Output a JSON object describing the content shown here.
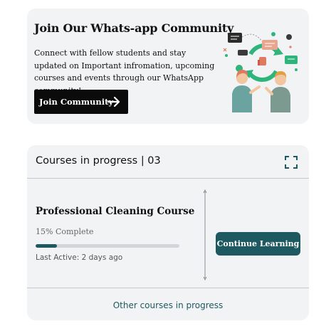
{
  "community": {
    "title": "Join Our Whats-app Community",
    "description": "Connect with fellow students and stay updated on Important infromation, upcoming courses and events through our WhatsApp community!",
    "button_label": "Join Community"
  },
  "courses_panel": {
    "header": "Courses in progress | 03",
    "course": {
      "title": "Professional Cleaning Course",
      "progress_text": "15% Complete",
      "progress_percent": 15,
      "last_active": "Last Active: 2 days ago"
    },
    "continue_label": "Continue Learning",
    "footer_link": "Other courses in progress"
  },
  "colors": {
    "accent": "#1e5860",
    "illustration_green": "#2fb57c",
    "card_bg": "#f2f3f5"
  },
  "icons": [
    "arrow-right-icon",
    "expand-icon",
    "community-illustration"
  ]
}
